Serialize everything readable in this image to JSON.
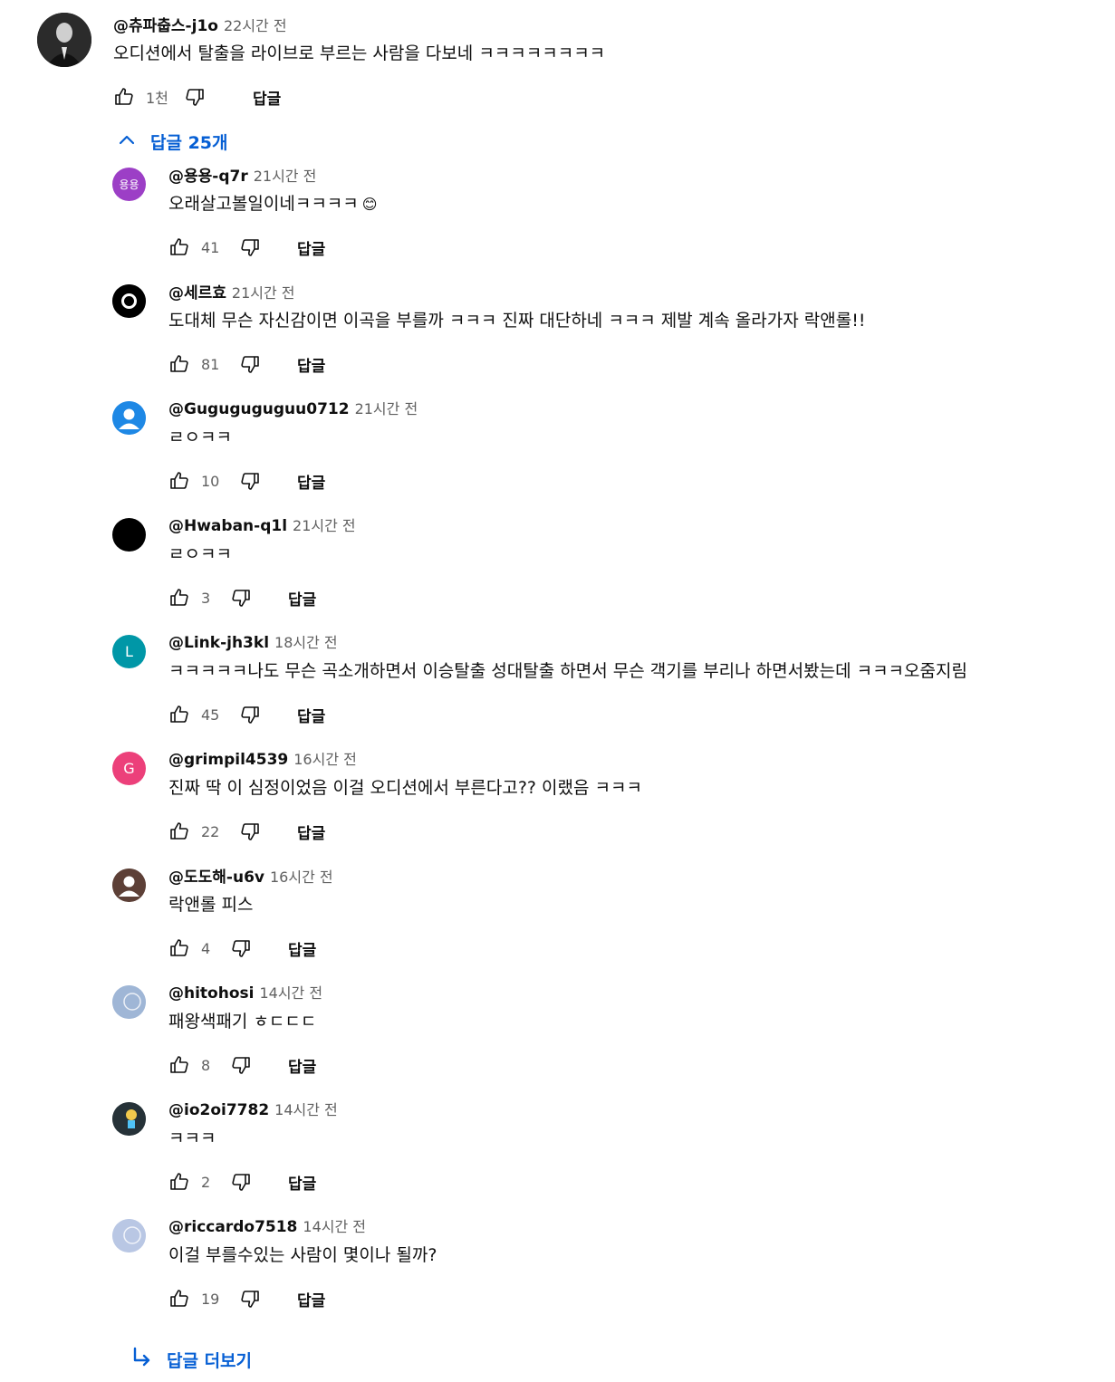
{
  "top_comment": {
    "author": "@츄파춥스-j1o",
    "time": "22시간 전",
    "text": "오디션에서 탈출을 라이브로 부르는 사람을 다보네 ㅋㅋㅋㅋㅋㅋㅋㅋ",
    "likes": "1천",
    "reply_label": "답글"
  },
  "replies_toggle": {
    "label": "답글 25개",
    "icon": "chevron-up-icon"
  },
  "replies": [
    {
      "author": "@용용-q7r",
      "time": "21시간 전",
      "text": "오래살고볼일이네ㅋㅋㅋㅋ",
      "emoji": "😊",
      "likes": "41",
      "reply_label": "답글",
      "avatar_text": "용용",
      "avatar_color": "#9c3fc6"
    },
    {
      "author": "@세르효",
      "time": "21시간 전",
      "text": "도대체 무슨 자신감이면 이곡을 부를까 ㅋㅋㅋ 진짜 대단하네 ㅋㅋㅋ 제발 계속 올라가자 락앤롤!!",
      "likes": "81",
      "reply_label": "답글",
      "avatar_text": "",
      "avatar_color": "#000000"
    },
    {
      "author": "@Guguguguguu0712",
      "time": "21시간 전",
      "text": "ㄹㅇㅋㅋ",
      "likes": "10",
      "reply_label": "답글",
      "avatar_text": "",
      "avatar_color": "#1e88e5"
    },
    {
      "author": "@Hwaban-q1l",
      "time": "21시간 전",
      "text": "ㄹㅇㅋㅋ",
      "likes": "3",
      "reply_label": "답글",
      "avatar_text": "",
      "avatar_color": "#000000"
    },
    {
      "author": "@Link-jh3kl",
      "time": "18시간 전",
      "text": "ㅋㅋㅋㅋㅋ나도 무슨 곡소개하면서 이승탈출 성대탈출 하면서 무슨 객기를 부리나 하면서봤는데 ㅋㅋㅋ오줌지림",
      "likes": "45",
      "reply_label": "답글",
      "avatar_text": "L",
      "avatar_color": "#0097a7"
    },
    {
      "author": "@grimpil4539",
      "time": "16시간 전",
      "text": "진짜 딱 이 심정이었음 이걸 오디션에서 부른다고?? 이랬음 ㅋㅋㅋ",
      "likes": "22",
      "reply_label": "답글",
      "avatar_text": "G",
      "avatar_color": "#ec407a"
    },
    {
      "author": "@도도해-u6v",
      "time": "16시간 전",
      "text": "락앤롤 피스",
      "likes": "4",
      "reply_label": "답글",
      "avatar_text": "",
      "avatar_color": "#5d4037"
    },
    {
      "author": "@hitohosi",
      "time": "14시간 전",
      "text": "패왕색패기 ㅎㄷㄷㄷ",
      "likes": "8",
      "reply_label": "답글",
      "avatar_text": "",
      "avatar_color": "#9fb6d6"
    },
    {
      "author": "@io2oi7782",
      "time": "14시간 전",
      "text": "ㅋㅋㅋ",
      "likes": "2",
      "reply_label": "답글",
      "avatar_text": "",
      "avatar_color": "#263238"
    },
    {
      "author": "@riccardo7518",
      "time": "14시간 전",
      "text": "이걸 부를수있는 사람이 몇이나 될까?",
      "likes": "19",
      "reply_label": "답글",
      "avatar_text": "",
      "avatar_color": "#b9c7e4"
    }
  ],
  "more_replies": {
    "label": "답글 더보기",
    "icon": "reply-arrow-icon"
  }
}
